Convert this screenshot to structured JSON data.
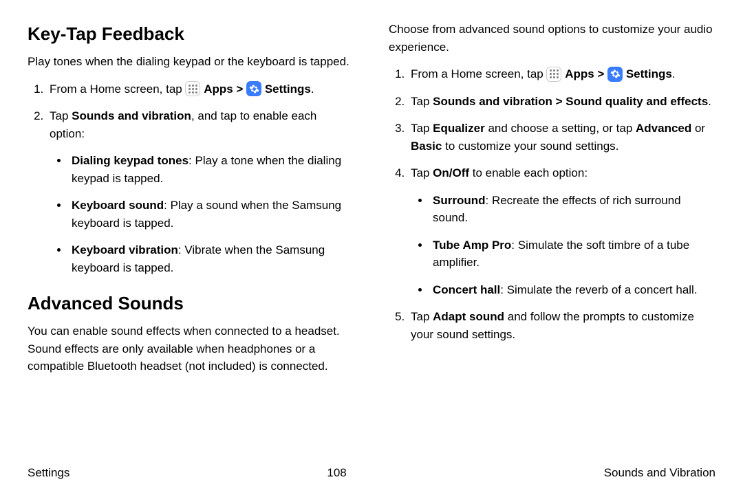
{
  "left": {
    "heading1": "Key-Tap Feedback",
    "intro1": "Play tones when the dialing keypad or the keyboard is tapped.",
    "step1_a": "From a Home screen, tap ",
    "apps_label": "Apps",
    "chevron": " > ",
    "settings_label": "Settings",
    "period": ".",
    "step2_a": "Tap ",
    "step2_b": "Sounds and vibration",
    "step2_c": ", and tap to enable each option:",
    "bullet1_b": "Dialing keypad tones",
    "bullet1_t": ": Play a tone when the dialing keypad is tapped.",
    "bullet2_b": "Keyboard sound",
    "bullet2_t": ": Play a sound when the Samsung keyboard is tapped.",
    "bullet3_b": "Keyboard vibration",
    "bullet3_t": ": Vibrate when the Samsung keyboard is tapped.",
    "heading2": "Advanced Sounds",
    "intro2": "You can enable sound effects when connected to a headset. Sound effects are only available when headphones or a compatible Bluetooth headset (not included) is connected."
  },
  "right": {
    "intro": "Choose from advanced sound options to customize your audio experience.",
    "step1_a": "From a Home screen, tap ",
    "apps_label": "Apps",
    "chevron": " > ",
    "settings_label": "Settings",
    "period": ".",
    "step2_a": "Tap ",
    "step2_b": "Sounds and vibration > Sound quality and effects",
    "step2_c": ".",
    "step3_a": "Tap ",
    "step3_b": "Equalizer",
    "step3_c": " and choose a setting, or tap ",
    "step3_d": "Advanced",
    "step3_e": " or ",
    "step3_f": "Basic",
    "step3_g": " to customize your sound settings.",
    "step4_a": "Tap ",
    "step4_b": "On/Off",
    "step4_c": " to enable each option:",
    "b1_b": "Surround",
    "b1_t": ": Recreate the effects of rich surround sound.",
    "b2_b": "Tube Amp Pro",
    "b2_t": ": Simulate the soft timbre of a tube amplifier.",
    "b3_b": "Concert hall",
    "b3_t": ": Simulate the reverb of a concert hall.",
    "step5_a": "Tap ",
    "step5_b": "Adapt sound",
    "step5_c": " and follow the prompts to customize your sound settings."
  },
  "footer": {
    "left": "Settings",
    "center": "108",
    "right": "Sounds and Vibration"
  }
}
